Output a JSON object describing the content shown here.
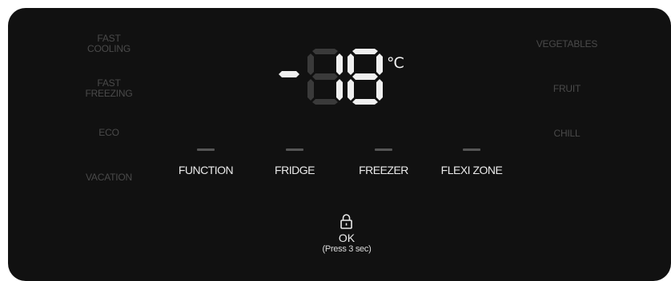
{
  "left_modes": [
    {
      "line1": "FAST",
      "line2": "COOLING"
    },
    {
      "line1": "FAST",
      "line2": "FREEZING"
    },
    {
      "line1": "ECO",
      "line2": ""
    },
    {
      "line1": "VACATION",
      "line2": ""
    }
  ],
  "right_modes": [
    {
      "label": "VEGETABLES"
    },
    {
      "label": "FRUIT"
    },
    {
      "label": "CHILL"
    }
  ],
  "temperature": {
    "value": "-18",
    "unit": "°C"
  },
  "selectors": [
    {
      "label": "FUNCTION"
    },
    {
      "label": "FRIDGE"
    },
    {
      "label": "FREEZER"
    },
    {
      "label": "FLEXI ZONE"
    }
  ],
  "lock": {
    "label": "OK",
    "hint": "(Press 3 sec)",
    "icon": "lock-icon"
  },
  "colors": {
    "panel": "#111111",
    "active_text": "#eaeaea",
    "inactive_text": "#4a4a4a",
    "segment_on": "#f0f0f0",
    "segment_off": "#3a3a3a"
  }
}
